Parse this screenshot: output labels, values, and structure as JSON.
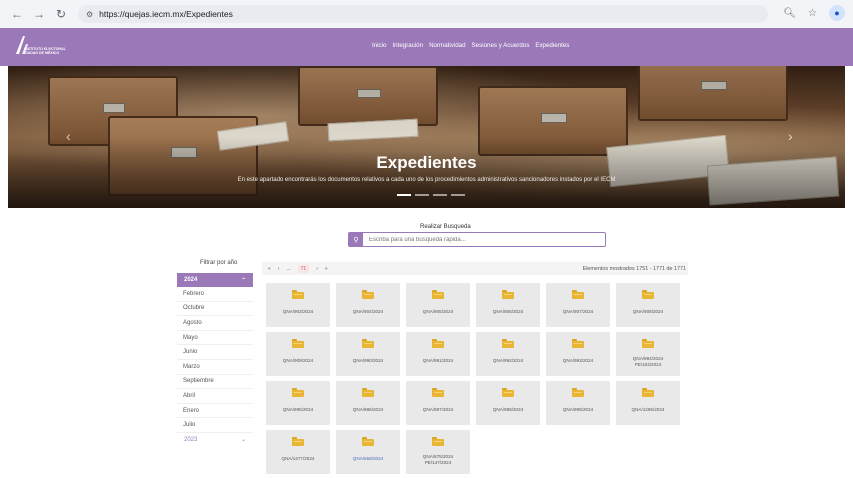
{
  "browser": {
    "url": "https://quejas.iecm.mx/Expedientes"
  },
  "header": {
    "logo_text": "INSTITUTO ELECTORAL CIUDAD DE MÉXICO",
    "nav": [
      "Inicio",
      "Integración",
      "Normatividad",
      "Sesiones y Acuerdos",
      "Expedientes"
    ]
  },
  "hero": {
    "title": "Expedientes",
    "subtitle": "En este apartado encontrarás los documentos relativos a cada uno de los procedimientos administrativos sancionadores instados por el IECM"
  },
  "search": {
    "label": "Realizar Busqueda",
    "placeholder": "Escriba para una busqueda rápida..."
  },
  "filter": {
    "label": "Filtrar por año",
    "active_year": "2024",
    "months": [
      "Febrero",
      "Octubre",
      "Agosto",
      "Mayo",
      "Junio",
      "Marzo",
      "Septiembre",
      "Abril",
      "Enero",
      "Julio"
    ],
    "collapsed_year": "2023"
  },
  "pagination": {
    "first": "«",
    "prev": "‹",
    "ellipsis": "...",
    "current": "71",
    "next": "›",
    "last": "»",
    "count": "Elementos mostrados 1751 - 1771 de 1771"
  },
  "cards": [
    {
      "label": "QNA/903/2024"
    },
    {
      "label": "QNA/904/2024"
    },
    {
      "label": "QNA/905/2024"
    },
    {
      "label": "QNA/906/2024"
    },
    {
      "label": "QNA/907/2024"
    },
    {
      "label": "QNA/908/2024"
    },
    {
      "label": "QNA/909/2024"
    },
    {
      "label": "QNA/990/2024"
    },
    {
      "label": "QNA/991/2024"
    },
    {
      "label": "QNA/992/2024"
    },
    {
      "label": "QNA/993/2024"
    },
    {
      "label": "QNA/994/2024",
      "label2": "PE/104/2024"
    },
    {
      "label": "QNA/995/2024"
    },
    {
      "label": "QNA/996/2024"
    },
    {
      "label": "QNA/997/2024"
    },
    {
      "label": "QNA/998/2024"
    },
    {
      "label": "QNA/999/2024"
    },
    {
      "label": "QNA/1295/2024"
    },
    {
      "label": "QNA/1477/2024"
    },
    {
      "label": "QNA/659/2024",
      "link": true
    },
    {
      "label": "QNA/675/2024",
      "label2": "PE/147/2024"
    }
  ],
  "colors": {
    "brand": "#9b79b9",
    "folder": "#e8b634",
    "card_bg": "#e9e9e9"
  }
}
